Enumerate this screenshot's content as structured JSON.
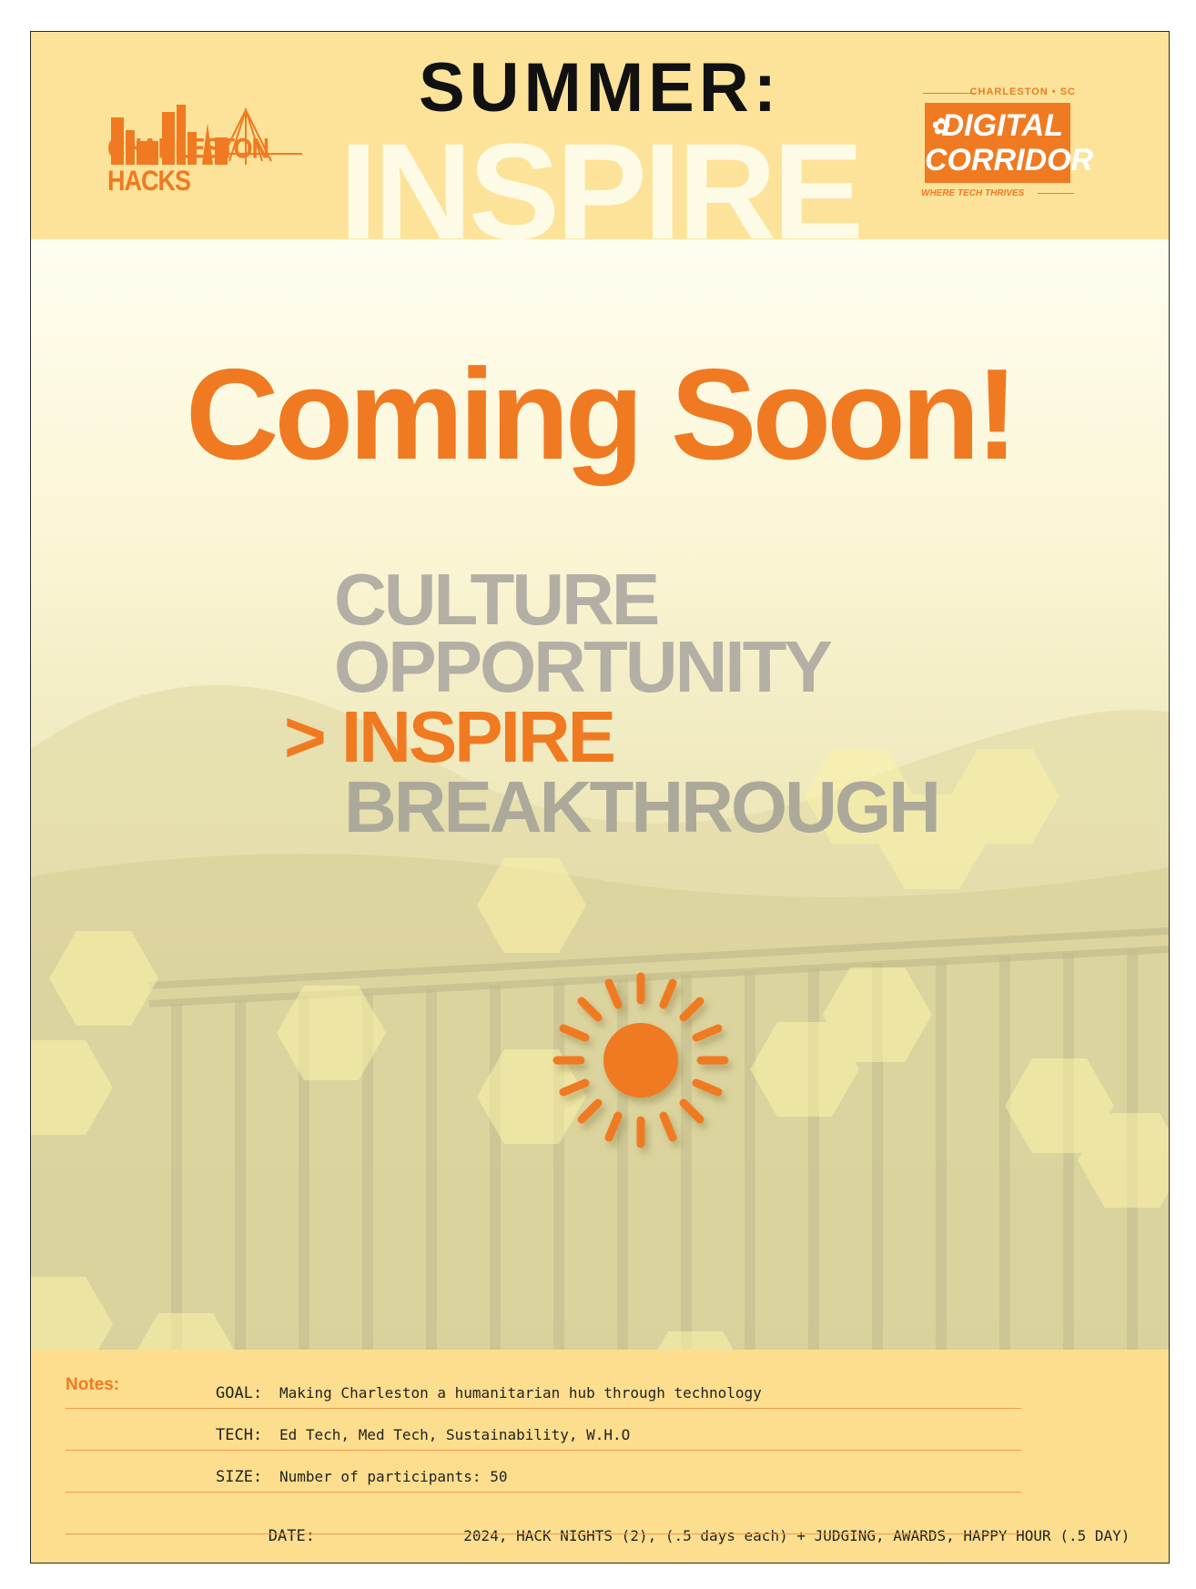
{
  "header": {
    "summer": "SUMMER:",
    "inspire": "INSPIRE",
    "logo_left": "CHARLESTON HACKS",
    "logo_right": {
      "top": "CHARLESTON • SC",
      "line1": "DIGITAL",
      "line2": "CORRIDOR",
      "tagline": "WHERE TECH THRIVES"
    }
  },
  "headline": "Coming Soon!",
  "words": [
    "CULTURE",
    "OPPORTUNITY",
    "> INSPIRE",
    "BREAKTHROUGH"
  ],
  "notes": {
    "label": "Notes:",
    "rows": [
      {
        "key": "GOAL:",
        "value": "Making Charleston a humanitarian hub through technology"
      },
      {
        "key": "TECH:",
        "value": "Ed Tech, Med Tech, Sustainability, W.H.O"
      },
      {
        "key": "SIZE:",
        "value": "Number of participants: 50"
      },
      {
        "key": "DATE:",
        "value": "               2024, HACK NIGHTS (2), (.5 days each) + JUDGING, AWARDS, HAPPY HOUR (.5 DAY)"
      }
    ]
  },
  "colors": {
    "accent": "#f07a22",
    "header_bg": "#fde39a",
    "notes_bg": "#fdde8e",
    "muted_word": "#b3afa5"
  },
  "icons": [
    "skyline-logo-icon",
    "flower-logo-icon",
    "sun-icon"
  ]
}
